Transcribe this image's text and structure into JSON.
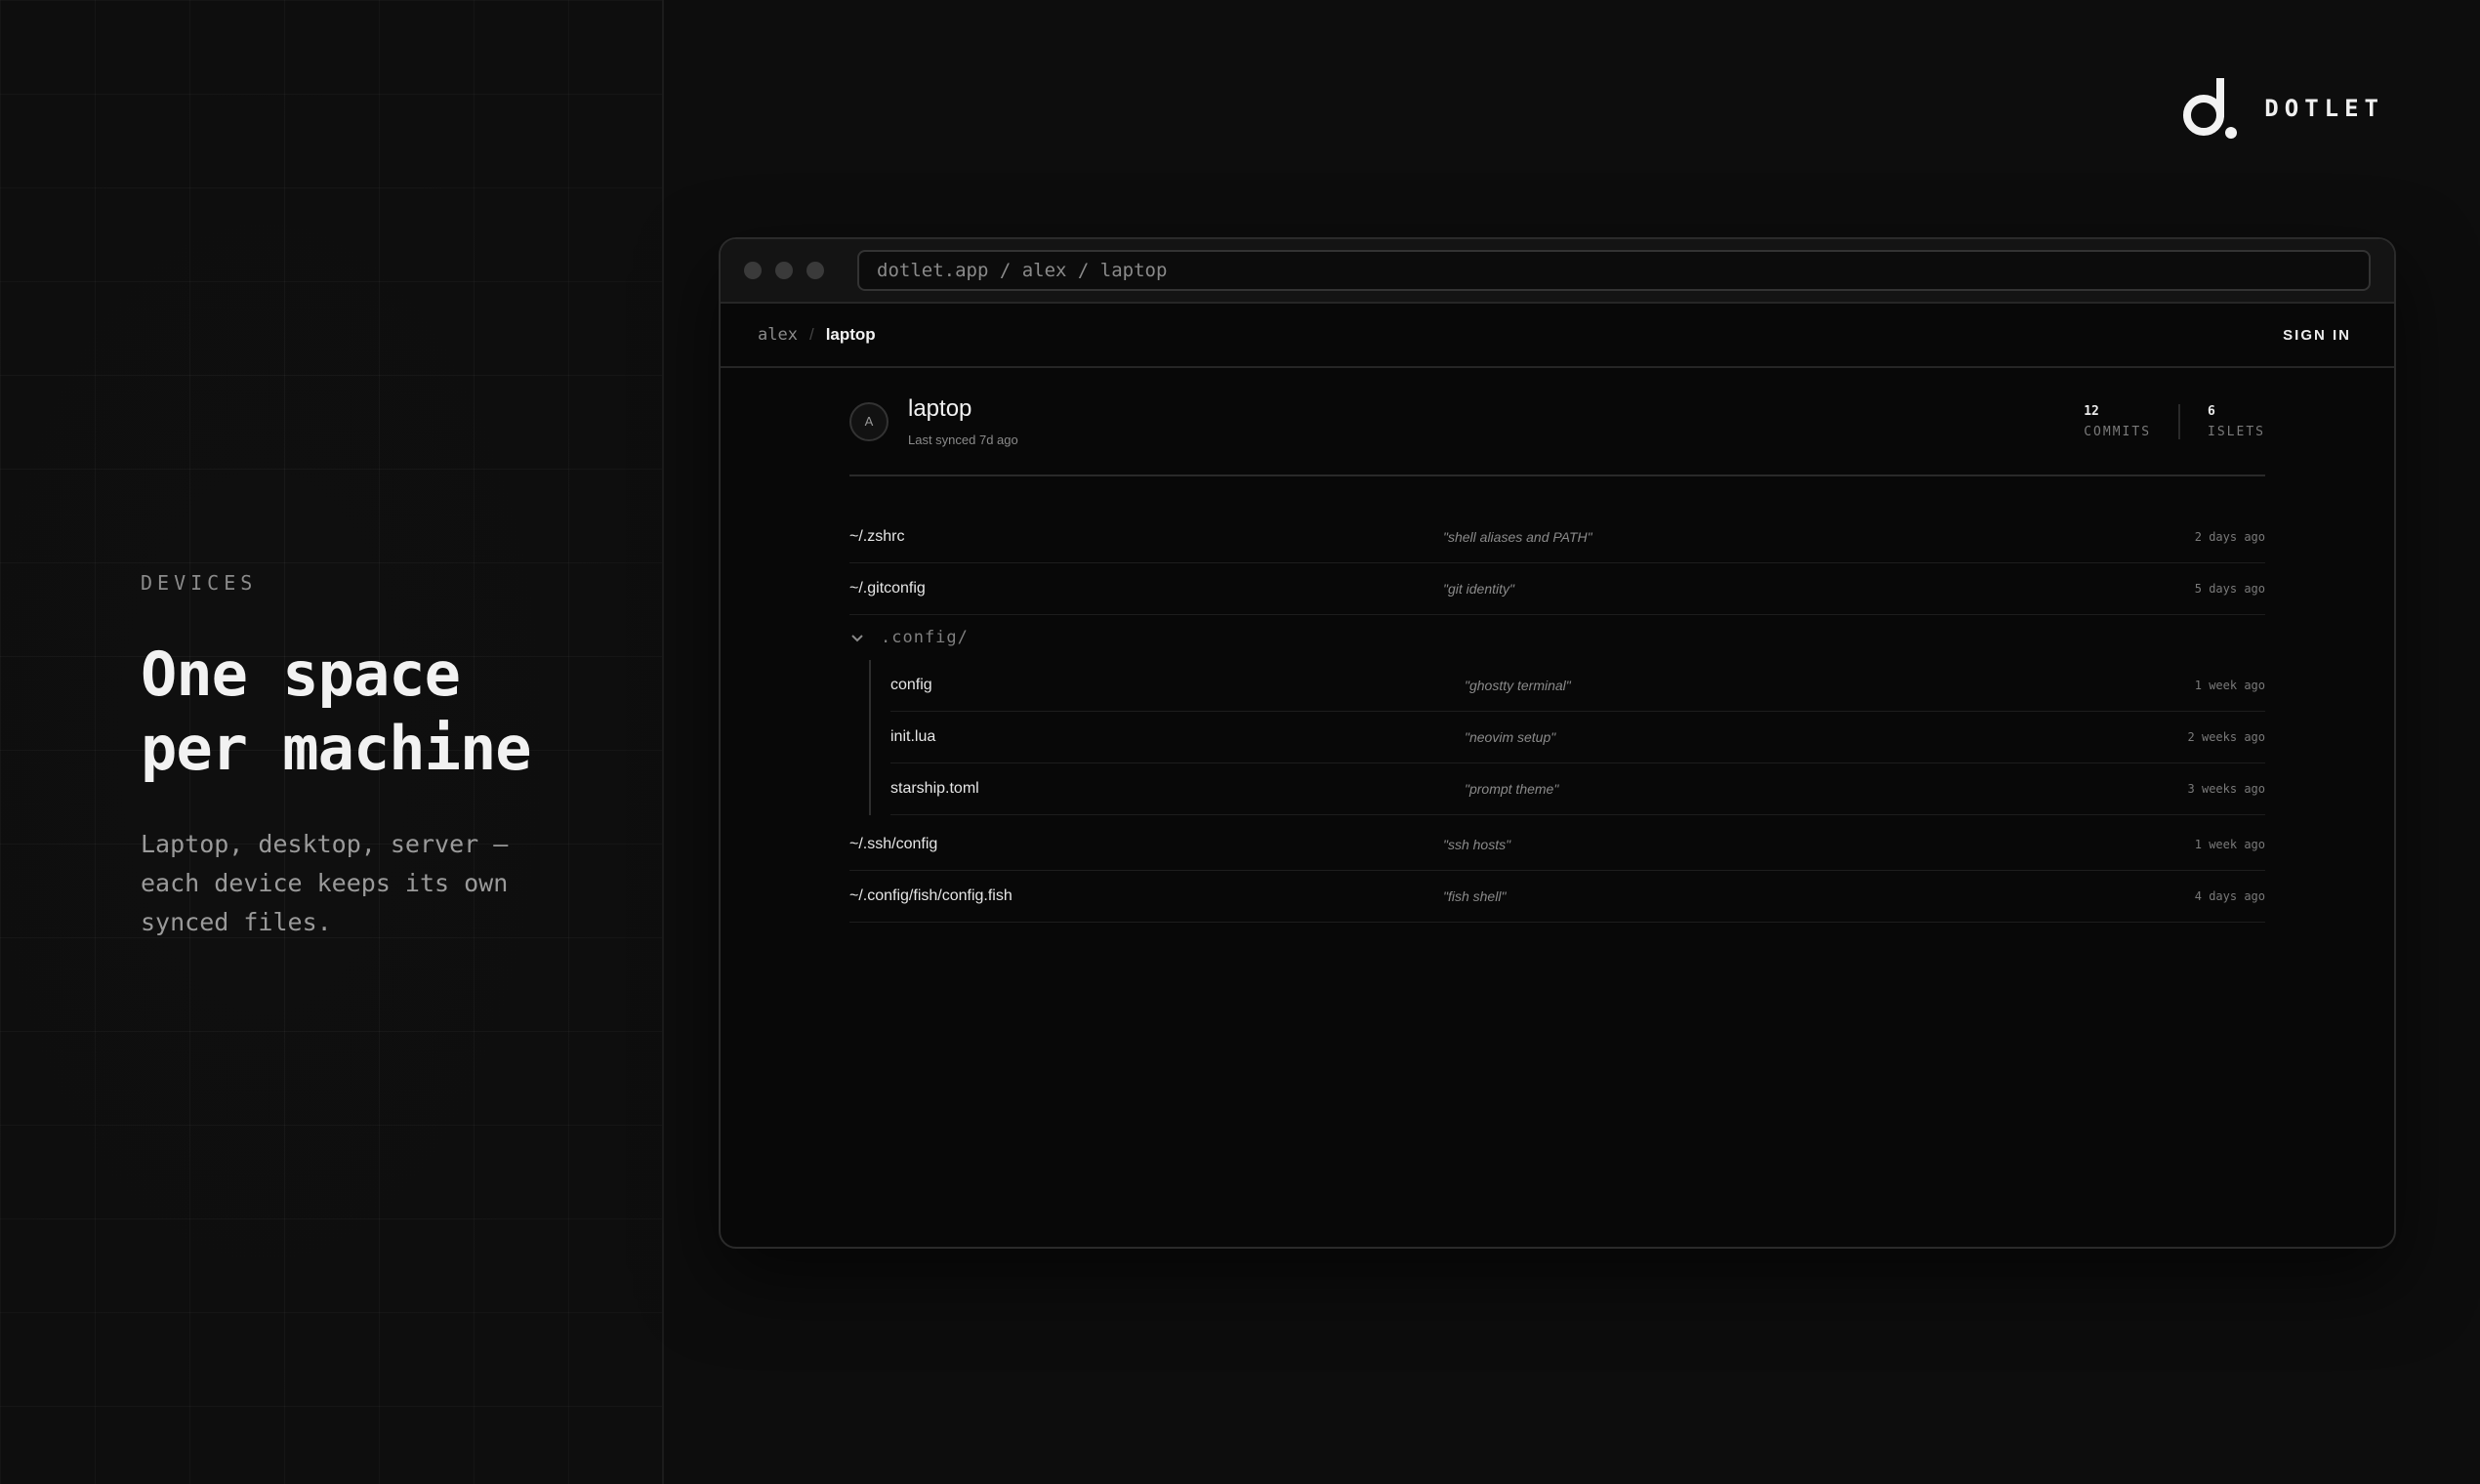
{
  "hero": {
    "eyebrow": "DEVICES",
    "title": "One space\nper machine",
    "description": "Laptop, desktop, server —\neach device keeps its own\nsynced files."
  },
  "brand": {
    "name": "DOTLET",
    "logo_icon": "dotlet-logo-icon"
  },
  "browser": {
    "url": "dotlet.app / alex / laptop"
  },
  "appbar": {
    "breadcrumb": {
      "user": "alex",
      "separator": "/",
      "device": "laptop"
    },
    "signin_label": "SIGN IN"
  },
  "device": {
    "avatar_initial": "A",
    "name": "laptop",
    "last_synced": "Last synced 7d ago",
    "stats": [
      {
        "value": "12",
        "label": "COMMITS"
      },
      {
        "value": "6",
        "label": "ISLETS"
      }
    ]
  },
  "files": {
    "top": [
      {
        "name": "~/.zshrc",
        "message": "\"shell aliases and PATH\"",
        "time": "2 days ago"
      },
      {
        "name": "~/.gitconfig",
        "message": "\"git identity\"",
        "time": "5 days ago"
      }
    ],
    "folder": {
      "name": ".config/",
      "expanded": true,
      "children": [
        {
          "name": "config",
          "message": "\"ghostty terminal\"",
          "time": "1 week ago"
        },
        {
          "name": "init.lua",
          "message": "\"neovim setup\"",
          "time": "2 weeks ago"
        },
        {
          "name": "starship.toml",
          "message": "\"prompt theme\"",
          "time": "3 weeks ago"
        }
      ]
    },
    "bottom": [
      {
        "name": "~/.ssh/config",
        "message": "\"ssh hosts\"",
        "time": "1 week ago"
      },
      {
        "name": "~/.config/fish/config.fish",
        "message": "\"fish shell\"",
        "time": "4 days ago"
      }
    ]
  }
}
